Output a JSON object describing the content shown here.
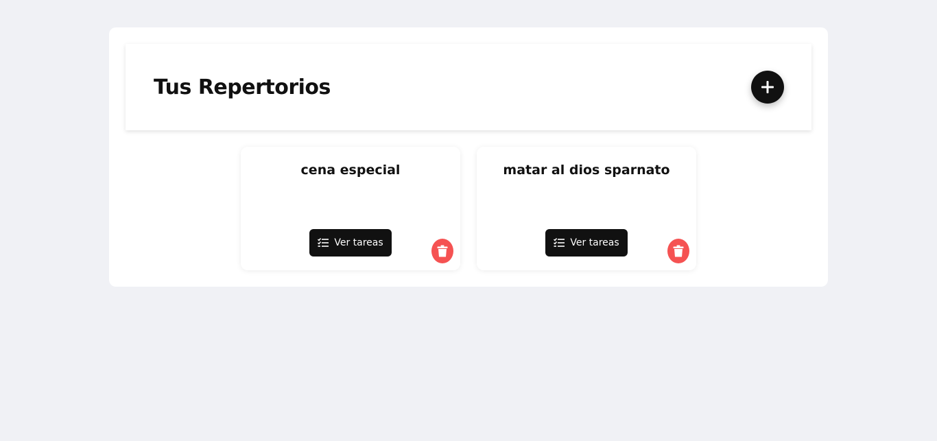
{
  "header": {
    "title": "Tus Repertorios",
    "add_icon": "plus-icon"
  },
  "cards": [
    {
      "title": "cena especial",
      "view_label": "Ver tareas",
      "view_icon": "checklist-icon",
      "delete_icon": "trash-icon"
    },
    {
      "title": "matar al dios sparnato",
      "view_label": "Ver tareas",
      "view_icon": "checklist-icon",
      "delete_icon": "trash-icon"
    }
  ],
  "colors": {
    "background": "#f0f1f5",
    "primary": "#111111",
    "danger": "#f55252"
  }
}
